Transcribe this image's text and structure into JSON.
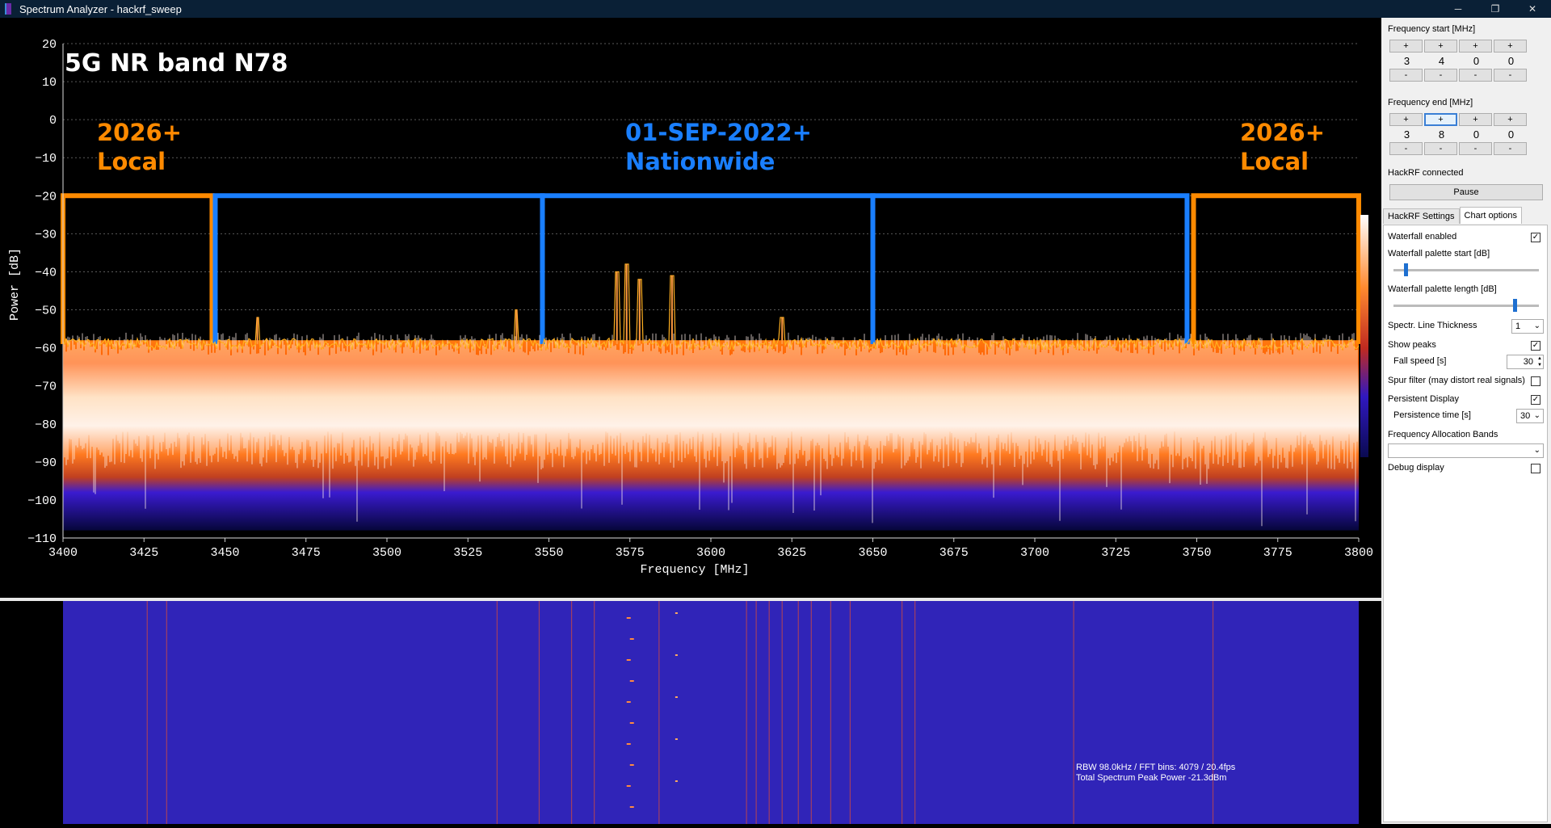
{
  "window": {
    "title": "Spectrum Analyzer - hackrf_sweep",
    "controls": {
      "minimize": "─",
      "restore": "❐",
      "close": "✕"
    }
  },
  "chart": {
    "title": "5G NR band N78",
    "ylabel": "Power [dB]",
    "xlabel": "Frequency [MHz]",
    "yticks": [
      "20",
      "10",
      "0",
      "−10",
      "−20",
      "−30",
      "−40",
      "−50",
      "−60",
      "−70",
      "−80",
      "−90",
      "−100",
      "−110"
    ],
    "xticks": [
      "3400",
      "3425",
      "3450",
      "3475",
      "3500",
      "3525",
      "3550",
      "3575",
      "3600",
      "3625",
      "3650",
      "3675",
      "3700",
      "3725",
      "3750",
      "3775",
      "3800"
    ],
    "annotations": {
      "left_year": "2026+",
      "left_scope": "Local",
      "center_date": "01-SEP-2022+",
      "center_scope": "Nationwide",
      "right_year": "2026+",
      "right_scope": "Local"
    },
    "colors": {
      "local": "#ff8a00",
      "nationwide": "#1a7fff",
      "trace": "#ffb020"
    }
  },
  "chart_data": {
    "type": "line",
    "title": "5G NR band N78",
    "xlabel": "Frequency [MHz]",
    "ylabel": "Power [dB]",
    "xlim": [
      3400,
      3800
    ],
    "ylim": [
      -110,
      20
    ],
    "noise_floor_db": -59,
    "peaks": [
      {
        "x": 3460,
        "y": -52
      },
      {
        "x": 3540,
        "y": -50
      },
      {
        "x": 3571,
        "y": -40
      },
      {
        "x": 3574,
        "y": -38
      },
      {
        "x": 3578,
        "y": -42
      },
      {
        "x": 3588,
        "y": -41
      },
      {
        "x": 3622,
        "y": -52
      }
    ],
    "bands": [
      {
        "label": "Local",
        "from": 3400,
        "to": 3446,
        "level": -20
      },
      {
        "label": "Nationwide",
        "from": 3447,
        "to": 3548,
        "level": -20
      },
      {
        "label": "Nationwide",
        "from": 3548,
        "to": 3650,
        "level": -20
      },
      {
        "label": "Nationwide",
        "from": 3650,
        "to": 3747,
        "level": -20
      },
      {
        "label": "Local",
        "from": 3749,
        "to": 3800,
        "level": -20
      }
    ]
  },
  "waterfall": {
    "info_line1": "RBW 98.0kHz / FFT bins: 4079 / 20.4fps",
    "info_line2": "Total Spectrum Peak Power -21.3dBm"
  },
  "panel": {
    "freq_start_label": "Frequency start [MHz]",
    "freq_start_digits": [
      "3",
      "4",
      "0",
      "0"
    ],
    "freq_end_label": "Frequency end [MHz]",
    "freq_end_digits": [
      "3",
      "8",
      "0",
      "0"
    ],
    "plus": "+",
    "minus": "-",
    "status": "HackRF connected",
    "pause_label": "Pause",
    "tabs": [
      "HackRF Settings",
      "Chart options"
    ],
    "options": {
      "waterfall_enabled": "Waterfall enabled",
      "palette_start": "Waterfall palette start [dB]",
      "palette_length": "Waterfall palette length [dB]",
      "line_thickness": "Spectr. Line Thickness",
      "line_thickness_value": "1",
      "show_peaks": "Show peaks",
      "fall_speed": "Fall speed [s]",
      "fall_speed_value": "30",
      "spur_filter": "Spur filter (may distort real signals)",
      "persistent_display": "Persistent Display",
      "persistence_time": "Persistence time [s]",
      "persistence_time_value": "30",
      "allocation_bands": "Frequency Allocation Bands",
      "allocation_bands_value": "",
      "debug_display": "Debug display"
    },
    "checks": {
      "waterfall": "✓",
      "peaks": "✓",
      "persistent": "✓",
      "spur": "",
      "debug": ""
    },
    "palette_start_pct": 0.07,
    "palette_length_pct": 0.82
  }
}
